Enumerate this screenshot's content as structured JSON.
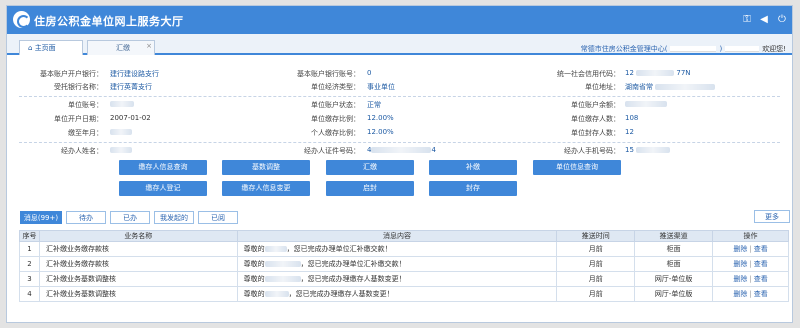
{
  "header": {
    "title": "住房公积金单位网上服务大厅"
  },
  "icons": [
    "key-icon",
    "volume-icon",
    "power-icon"
  ],
  "tabs": [
    {
      "label": "主页面",
      "icon": "home-icon"
    },
    {
      "label": "汇缴"
    }
  ],
  "welcome": {
    "prefix": "常德市住房公积金管理中心(",
    "suffix": "欢迎您!"
  },
  "info": {
    "r1": {
      "a_label": "基本账户开户银行：",
      "a_value": "建行建设路支行",
      "b_label": "基本账户银行账号：",
      "b_value": "0",
      "c_label": "统一社会信用代码：",
      "c_value": "12",
      "c_value2": "77N"
    },
    "r2": {
      "a_label": "受托银行名称：",
      "a_value": "建行英菁支行",
      "b_label": "单位经济类型：",
      "b_value": "事业单位",
      "c_label": "单位地址：",
      "c_value": "湖南省常"
    },
    "r3": {
      "a_label": "单位账号：",
      "b_label": "单位账户状态：",
      "b_value": "正常",
      "c_label": "单位账户余额："
    },
    "r4": {
      "a_label": "单位开户日期：",
      "a_value": "2007-01-02",
      "b_label": "单位缴存比例：",
      "b_value": "12.00%",
      "c_label": "单位缴存人数：",
      "c_value": "108"
    },
    "r5": {
      "a_label": "缴至年月：",
      "b_label": "个人缴存比例：",
      "b_value": "12.00%",
      "c_label": "单位封存人数：",
      "c_value": "12"
    },
    "r6": {
      "a_label": "经办人姓名：",
      "b_label": "经办人证件号码：",
      "b_value": "4",
      "b_value2": "4",
      "c_label": "经办人手机号码：",
      "c_value": "15"
    }
  },
  "actions": [
    "缴存人信息查询",
    "基数调整",
    "汇缴",
    "补缴",
    "单位信息查询",
    "缴存人登记",
    "缴存人信息变更",
    "启封",
    "封存"
  ],
  "msg_tabs": [
    "消息(99+)",
    "待办",
    "已办",
    "我发起的",
    "已阅"
  ],
  "more": "更多",
  "table": {
    "headers": [
      "序号",
      "业务名称",
      "消息内容",
      "推送时间",
      "推送渠道",
      "操作"
    ],
    "rows": [
      {
        "no": "1",
        "name": "汇补缴业务缴存款核",
        "pre": "尊敬的",
        "post": "，您已完成办理单位汇补缴交款！",
        "time": "月前",
        "channel": "柜面",
        "del": "删除",
        "view": "查看"
      },
      {
        "no": "2",
        "name": "汇补缴业务缴存款核",
        "pre": "尊敬的",
        "post": "，您已完成办理单位汇补缴交款！",
        "time": "月前",
        "channel": "柜面",
        "del": "删除",
        "view": "查看"
      },
      {
        "no": "3",
        "name": "汇补缴业务基数调整核",
        "pre": "尊敬的",
        "post": "，您已完成办理缴存人基数变更！",
        "time": "月前",
        "channel": "网厅-单位版",
        "del": "删除",
        "view": "查看"
      },
      {
        "no": "4",
        "name": "汇补缴业务基数调整核",
        "pre": "尊敬的",
        "post": "，您已完成办理缴存人基数变更！",
        "time": "月前",
        "channel": "网厅-单位版",
        "del": "删除",
        "view": "查看"
      }
    ]
  }
}
